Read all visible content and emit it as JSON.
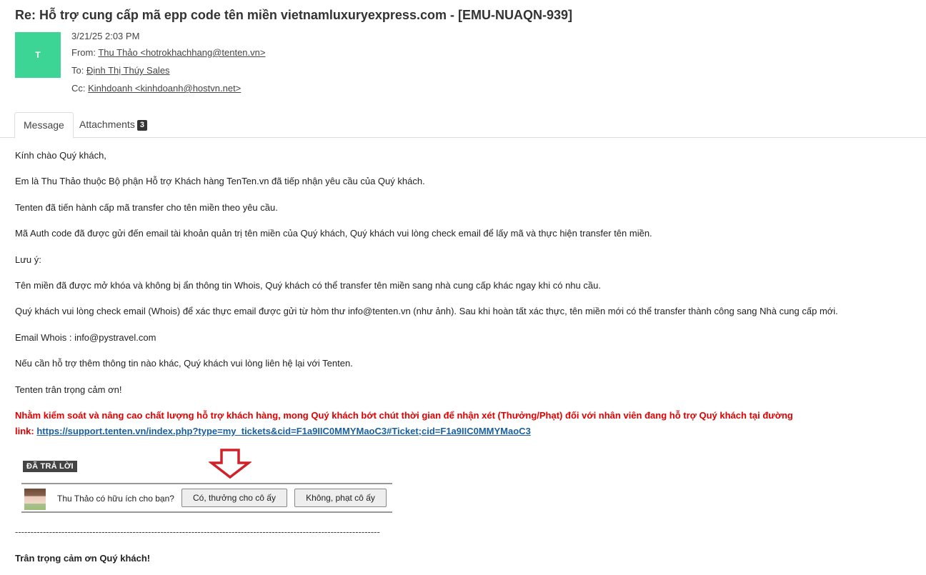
{
  "email": {
    "subject": "Re: Hỗ trợ cung cấp mã epp code tên miền vietnamluxuryexpress.com - [EMU-NUAQN-939]",
    "avatar_letter": "T",
    "avatar_color": "#3cd596",
    "date": "3/21/25 2:03 PM",
    "from_label": "From:",
    "from_value": "Thu Thảo <hotrokhachhang@tenten.vn>",
    "to_label": "To:",
    "to_value": "Định Thị Thúy Sales",
    "cc_label": "Cc:",
    "cc_value": "Kinhdoanh <kinhdoanh@hostvn.net>"
  },
  "tabs": {
    "message": "Message",
    "attachments": "Attachments",
    "attachments_count": "3"
  },
  "body": {
    "p1": "Kính chào Quý khách,",
    "p2": "Em là Thu Thảo thuộc Bộ phận Hỗ trợ Khách hàng TenTen.vn đã tiếp nhận yêu cầu của Quý khách.",
    "p3": "Tenten đã tiến hành cấp mã transfer cho tên miền theo yêu cầu.",
    "p4": "Mã Auth code đã được gửi đến email tài khoản quản trị tên miền của Quý khách, Quý khách vui lòng check email để lấy mã và thực hiện transfer tên miền.",
    "p5": "Lưu ý:",
    "p6": "Tên miền đã được mở khóa và không bị ẩn thông tin Whois, Quý khách có thể transfer tên miền sang nhà cung cấp khác ngay khi có nhu cầu.",
    "p7": "Quý khách vui lòng check email (Whois) để xác thực email được gửi từ hòm thư info@tenten.vn (như ảnh). Sau khi hoàn tất xác thực, tên miền mới có thể transfer thành công sang Nhà cung cấp mới.",
    "p8": "Email Whois : info@pystravel.com",
    "p9": "Nếu cần hỗ trợ thêm thông tin nào khác, Quý khách vui lòng liên hệ lại với Tenten.",
    "p10": "Tenten trân trọng cảm ơn!",
    "red_line1": "Nhằm kiểm soát và nâng cao chất lượng hỗ trợ khách hàng, mong Quý khách bớt chút thời gian để nhận xét (Thưởng/Phạt) đối với nhân viên đang hỗ trợ Quý khách tại đường",
    "red_prefix": "link:",
    "feedback_link": "https://support.tenten.vn/index.php?type=my_tickets&cid=F1a9IIC0MMYMaoC3#Ticket;cid=F1a9IIC0MMYMaoC3",
    "divider": "----------------------------------------------------------------------------------------------------------------------",
    "closing": "Trân trọng cảm ơn Quý khách!"
  },
  "widget": {
    "status_label": "ĐÃ TRẢ LỜI",
    "question": "Thu Thảo có hữu ích cho bạn?",
    "yes_button": "Có, thưởng cho cô ấy",
    "no_button": "Không, phạt cô ấy",
    "arrow_color": "#d0202a"
  }
}
